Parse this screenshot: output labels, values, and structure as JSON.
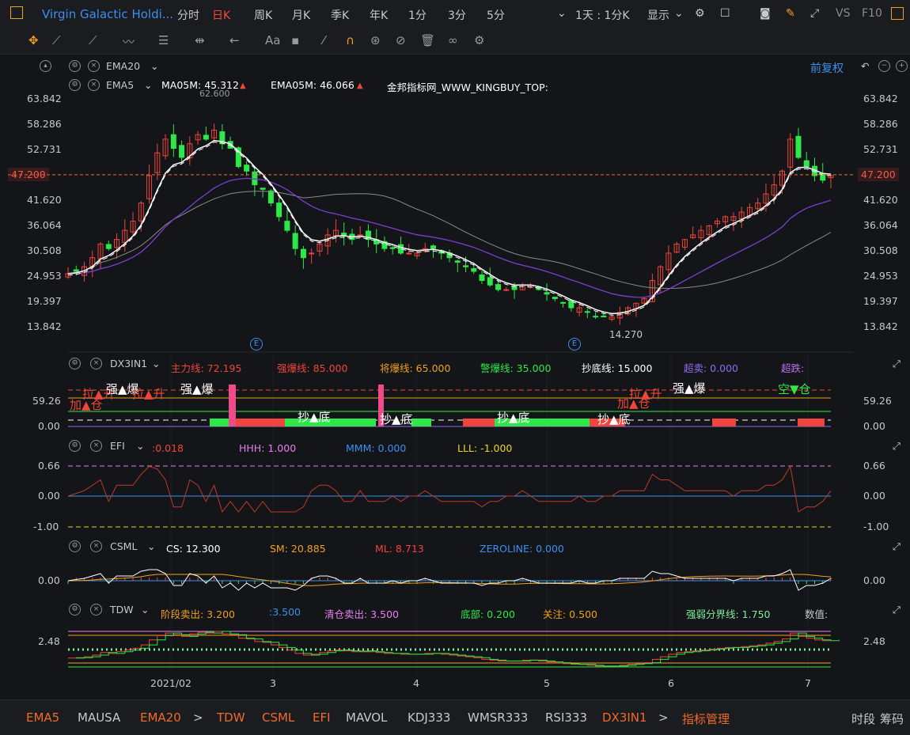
{
  "topbar": {
    "title": "Virgin Galactic Holdi...",
    "periods": [
      "分时",
      "日K",
      "日K",
      "周K",
      "月K",
      "季K",
      "年K",
      "1分",
      "3分",
      "5分"
    ],
    "period_items": [
      {
        "label": "分时",
        "active": false
      },
      {
        "label": "日K",
        "active": false
      },
      {
        "label": "日K",
        "active": true
      },
      {
        "label": "周K",
        "active": false
      },
      {
        "label": "月K",
        "active": false
      },
      {
        "label": "季K",
        "active": false
      },
      {
        "label": "年K",
        "active": false
      },
      {
        "label": "1分",
        "active": false
      },
      {
        "label": "3分",
        "active": false
      },
      {
        "label": "5分",
        "active": false
      }
    ],
    "day_label": "1天 : 1分K",
    "display_label": "显示",
    "vs_label": "VS",
    "f10_label": "F10"
  },
  "main_chart": {
    "ema20_label": "EMA20",
    "fuquan_label": "前复权",
    "ema5_label": "EMA5",
    "ma05m_label": "MA05M: 45.312",
    "ema05m_label": "EMA05M: 46.066",
    "watermark": "金邦指标网_WWW_KINGBUY_TOP:",
    "high_label": "62.600",
    "low_label": "14.270",
    "current_price": "47.200",
    "y_ticks": [
      "63.842",
      "58.286",
      "52.731",
      "47.200",
      "41.620",
      "36.064",
      "30.508",
      "24.953",
      "19.397",
      "13.842"
    ],
    "e_marker": "E"
  },
  "x_axis": {
    "ticks": [
      "2021/02",
      "3",
      "4",
      "5",
      "6",
      "7"
    ]
  },
  "dx3in1": {
    "name": "DX3IN1",
    "fields": [
      {
        "label": "主力线: 72.195",
        "color": "#f0453a"
      },
      {
        "label": "强爆线: 85.000",
        "color": "#f0453a"
      },
      {
        "label": "将爆线: 65.000",
        "color": "#f0a020"
      },
      {
        "label": "警爆线: 35.000",
        "color": "#2ee84a"
      },
      {
        "label": "抄底线: 15.000",
        "color": "#ffffff"
      },
      {
        "label": "超卖: 0.000",
        "color": "#8f6cf0"
      },
      {
        "label": "超跌:",
        "color": "#b874f0"
      }
    ],
    "y_ticks": [
      "59.26",
      "0.00"
    ],
    "annotations": [
      "加▲仓",
      "拉▲升",
      "强▲爆",
      "拉▲升",
      "强▲爆",
      "抄▲底",
      "抄▲底",
      "抄▲底",
      "抄▲底",
      "拉▲升",
      "加▲仓",
      "强▲爆",
      "空▼仓"
    ]
  },
  "efi": {
    "name": "EFI",
    "fields": [
      {
        "label": ":0.018",
        "color": "#f0453a"
      },
      {
        "label": "HHH: 1.000",
        "color": "#e77ff0"
      },
      {
        "label": "MMM: 0.000",
        "color": "#3a8ff0"
      },
      {
        "label": "LLL: -1.000",
        "color": "#e8d820"
      }
    ],
    "y_ticks": [
      "0.66",
      "0.00",
      "-1.00"
    ]
  },
  "csml": {
    "name": "CSML",
    "fields": [
      {
        "label": "CS: 12.300",
        "color": "#ffffff"
      },
      {
        "label": "SM: 20.885",
        "color": "#f0a020"
      },
      {
        "label": "ML: 8.713",
        "color": "#f0453a"
      },
      {
        "label": "ZEROLINE: 0.000",
        "color": "#3a8ff0"
      }
    ],
    "y_ticks": [
      "0.00"
    ]
  },
  "tdw": {
    "name": "TDW",
    "fields": [
      {
        "label": "阶段卖出: 3.200",
        "color": "#f0a020"
      },
      {
        "label": ":3.500",
        "color": "#3a8ff0"
      },
      {
        "label": "清仓卖出: 3.500",
        "color": "#e77ff0"
      },
      {
        "label": "底部: 0.200",
        "color": "#2ee84a"
      },
      {
        "label": "关注: 0.500",
        "color": "#f0a020"
      },
      {
        "label": "强弱分界线: 1.750",
        "color": "#7ff09a"
      },
      {
        "label": "数值:",
        "color": "#c8c8cc"
      }
    ],
    "y_ticks": [
      "2.48"
    ]
  },
  "bottombar": {
    "items": [
      {
        "label": "EMA5",
        "color": "#f06a2a"
      },
      {
        "label": "MAUSA",
        "color": "#c8c8cc"
      },
      {
        "label": "EMA20",
        "color": "#f06a2a"
      },
      {
        "label": ">",
        "color": "#c8c8cc"
      },
      {
        "label": "TDW",
        "color": "#f06a2a"
      },
      {
        "label": "CSML",
        "color": "#f06a2a"
      },
      {
        "label": "EFI",
        "color": "#f06a2a"
      },
      {
        "label": "MAVOL",
        "color": "#c8c8cc"
      },
      {
        "label": "KDJ333",
        "color": "#c8c8cc"
      },
      {
        "label": "WMSR333",
        "color": "#c8c8cc"
      },
      {
        "label": "RSI333",
        "color": "#c8c8cc"
      },
      {
        "label": "DX3IN1",
        "color": "#f06a2a"
      },
      {
        "label": ">",
        "color": "#c8c8cc"
      },
      {
        "label": "指标管理",
        "color": "#f06a2a"
      }
    ],
    "right_items": [
      "时段",
      "筹码"
    ]
  },
  "chart_data": {
    "type": "candlestick",
    "title": "Virgin Galactic Holdi...",
    "x_labels": [
      "2021/02",
      "3",
      "4",
      "5",
      "6",
      "7"
    ],
    "ylim": [
      13.842,
      63.842
    ],
    "current_price": 47.2,
    "high": 62.6,
    "low": 14.27,
    "close_path": [
      25.5,
      26,
      27,
      29,
      32,
      31,
      33,
      35,
      37,
      41,
      47,
      52,
      55,
      53,
      51,
      54,
      56,
      55,
      57,
      54,
      53,
      49,
      48,
      45,
      44,
      41,
      38,
      35,
      31,
      29,
      30,
      32,
      34,
      35,
      34,
      33,
      34,
      33,
      32,
      31,
      31,
      30,
      30,
      30,
      31,
      31,
      30,
      29,
      28,
      27,
      26,
      24,
      23,
      22,
      22,
      22,
      23,
      23,
      22,
      21,
      20,
      19,
      18,
      18,
      17,
      16,
      16,
      16,
      17,
      18,
      19,
      20,
      24,
      27,
      30,
      32,
      33,
      34,
      35,
      36,
      37,
      38,
      38,
      39,
      40,
      41,
      43,
      45,
      48,
      55,
      51,
      49,
      47,
      46,
      47
    ],
    "series": [
      {
        "name": "EMA5",
        "color": "#ffffff"
      },
      {
        "name": "EMA20",
        "color": "#7a3fd0"
      },
      {
        "name": "MA05M",
        "color": "#888888"
      }
    ]
  }
}
